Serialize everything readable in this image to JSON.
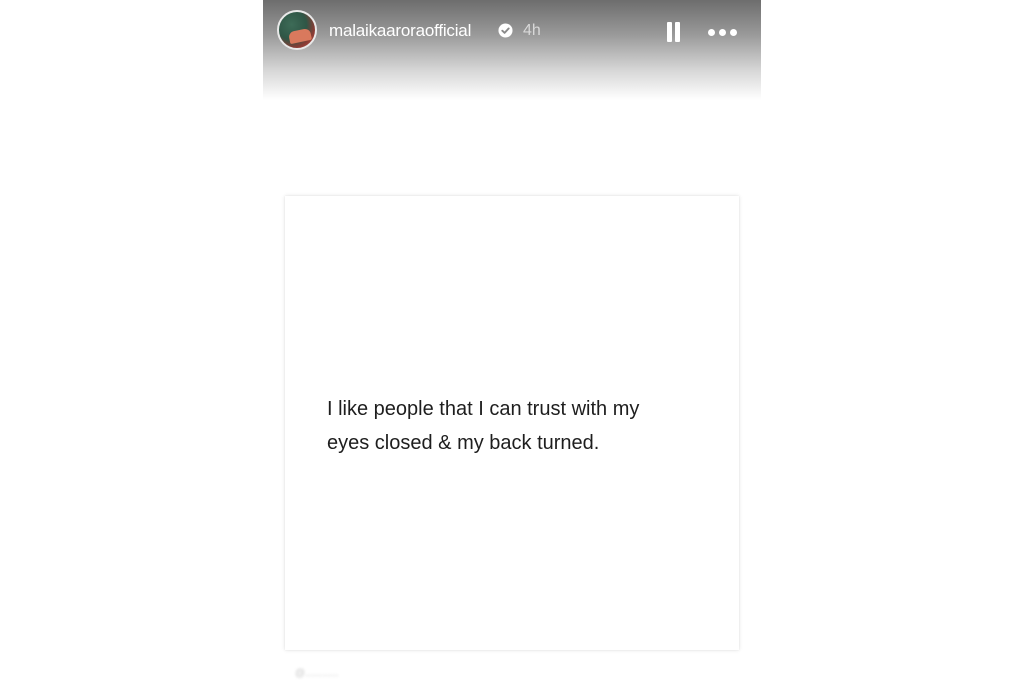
{
  "story": {
    "username": "malaikaaroraofficial",
    "time": "4h",
    "verified_icon": "verified-badge-icon",
    "pause_icon": "pause-icon",
    "more_icon": "more-options-icon"
  },
  "post": {
    "quote": "I like people that I can trust with my\neyes closed & my back turned.",
    "credit": "@............"
  },
  "colors": {
    "header_dark": "#6d6d6d",
    "text": "#1e1e1e",
    "background": "#ffffff"
  }
}
